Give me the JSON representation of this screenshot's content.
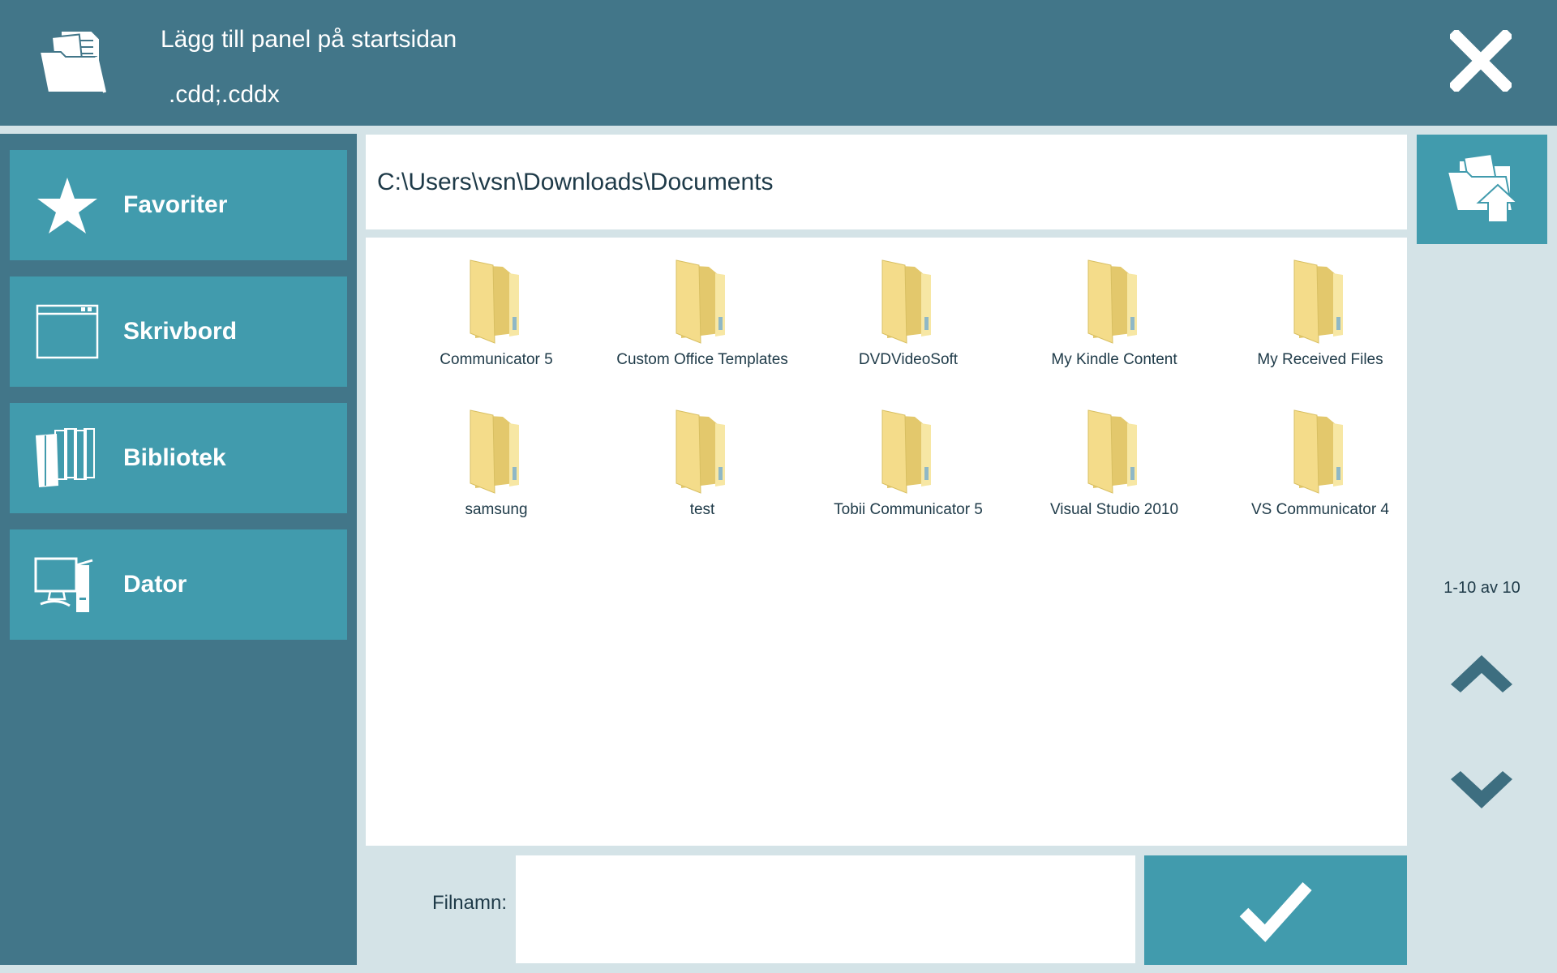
{
  "header": {
    "title": "Lägg till panel på startsidan",
    "subtitle": ".cdd;.cddx",
    "icon": "folder-documents-icon",
    "close_icon": "close-icon"
  },
  "sidebar": {
    "items": [
      {
        "label": "Favoriter",
        "icon": "star-icon"
      },
      {
        "label": "Skrivbord",
        "icon": "desktop-window-icon"
      },
      {
        "label": "Bibliotek",
        "icon": "library-books-icon"
      },
      {
        "label": "Dator",
        "icon": "computer-icon"
      }
    ]
  },
  "path": {
    "value": "C:\\Users\\vsn\\Downloads\\Documents"
  },
  "folders": [
    {
      "name": "Communicator 5"
    },
    {
      "name": "Custom Office Templates"
    },
    {
      "name": "DVDVideoSoft"
    },
    {
      "name": "My Kindle Content"
    },
    {
      "name": "My Received Files"
    },
    {
      "name": "samsung"
    },
    {
      "name": "test"
    },
    {
      "name": "Tobii Communicator 5"
    },
    {
      "name": "Visual Studio 2010"
    },
    {
      "name": "VS Communicator 4"
    }
  ],
  "pagination": {
    "text": "1-10 av 10",
    "up_icon": "chevron-up-icon",
    "down_icon": "chevron-down-icon"
  },
  "filename": {
    "label": "Filnamn:",
    "value": "",
    "placeholder": ""
  },
  "confirm": {
    "icon": "checkmark-icon"
  },
  "colors": {
    "header_bg": "#427689",
    "sidebar_bg": "#427689",
    "accent_button": "#419bad",
    "page_bg": "#d4e3e7",
    "chevron": "#3d6e80"
  }
}
